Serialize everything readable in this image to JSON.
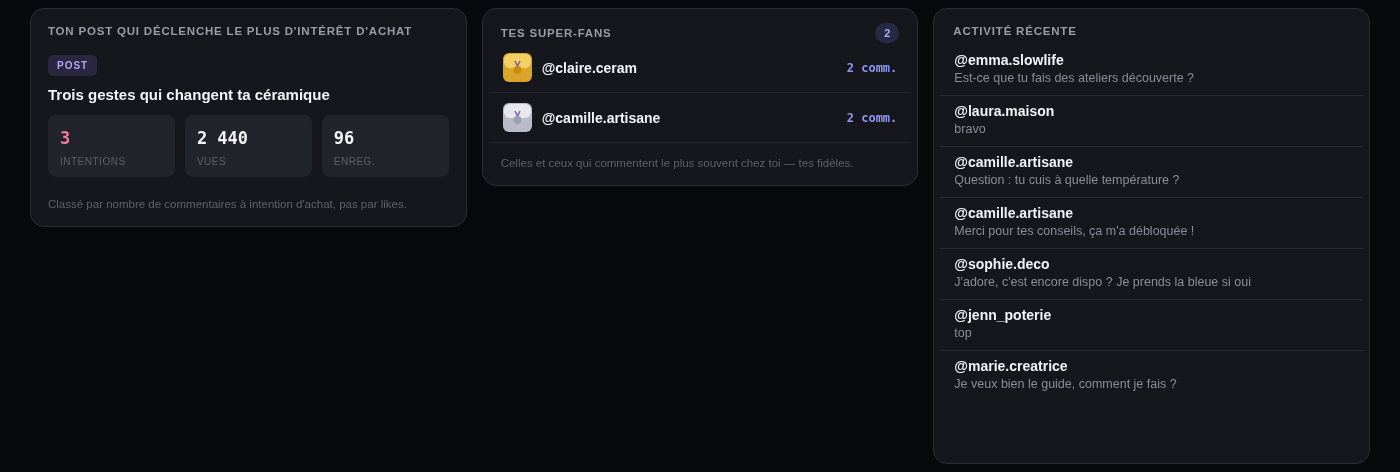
{
  "top_post": {
    "title": "TON POST QUI DÉCLENCHE LE PLUS D'INTÉRÊT D'ACHAT",
    "badge": "POST",
    "post_title": "Trois gestes qui changent ta céramique",
    "stats": [
      {
        "value": "3",
        "label": "INTENTIONS",
        "highlight": true
      },
      {
        "value": "2 440",
        "label": "VUES",
        "highlight": false
      },
      {
        "value": "96",
        "label": "ENREG.",
        "highlight": false
      }
    ],
    "footnote": "Classé par nombre de commentaires à intention d'achat, pas par likes."
  },
  "super_fans": {
    "title": "TES SUPER-FANS",
    "count": "2",
    "fans": [
      {
        "kind": "gold",
        "handle": "@claire.ceram",
        "comments": "2 comm."
      },
      {
        "kind": "silver",
        "handle": "@camille.artisane",
        "comments": "2 comm."
      }
    ],
    "footnote": "Celles et ceux qui commentent le plus souvent chez toi — tes fidèles."
  },
  "recent_activity": {
    "title": "ACTIVITÉ RÉCENTE",
    "items": [
      {
        "user": "@emma.slowlife",
        "text": "Est-ce que tu fais des ateliers découverte ?"
      },
      {
        "user": "@laura.maison",
        "text": "bravo"
      },
      {
        "user": "@camille.artisane",
        "text": "Question : tu cuis à quelle température ?"
      },
      {
        "user": "@camille.artisane",
        "text": "Merci pour tes conseils, ça m'a débloquée !"
      },
      {
        "user": "@sophie.deco",
        "text": "J'adore, c'est encore dispo ? Je prends la bleue si oui"
      },
      {
        "user": "@jenn_poterie",
        "text": "top"
      },
      {
        "user": "@marie.creatrice",
        "text": "Je veux bien le guide, comment je fais ?"
      }
    ]
  }
}
